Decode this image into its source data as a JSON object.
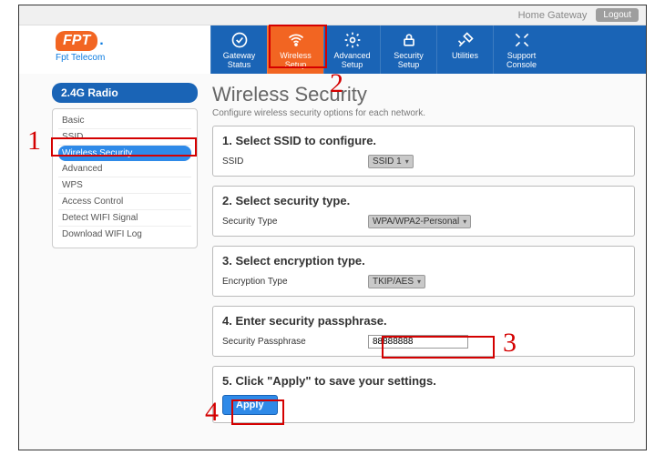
{
  "topbar": {
    "home": "Home Gateway",
    "logout": "Logout"
  },
  "brand": {
    "logo_main": "FPT",
    "logo_accent": ".",
    "sub": "Fpt Telecom"
  },
  "nav": [
    {
      "label": "Gateway\nStatus",
      "key": "gateway-status"
    },
    {
      "label": "Wireless\nSetup",
      "key": "wireless-setup"
    },
    {
      "label": "Advanced\nSetup",
      "key": "advanced-setup"
    },
    {
      "label": "Security\nSetup",
      "key": "security-setup"
    },
    {
      "label": "Utilities",
      "key": "utilities"
    },
    {
      "label": "Support\nConsole",
      "key": "support-console"
    }
  ],
  "sidebar": {
    "head": "2.4G Radio",
    "items": [
      "Basic",
      "SSID",
      "Wireless Security",
      "Advanced",
      "WPS",
      "Access Control",
      "Detect WIFI Signal",
      "Download WIFI Log"
    ],
    "active_index": 2
  },
  "page": {
    "title": "Wireless Security",
    "subtitle": "Configure wireless security options for each network."
  },
  "steps": {
    "s1": {
      "heading": "1. Select SSID to configure.",
      "label": "SSID",
      "value": "SSID 1"
    },
    "s2": {
      "heading": "2. Select security type.",
      "label": "Security Type",
      "value": "WPA/WPA2-Personal"
    },
    "s3": {
      "heading": "3. Select encryption type.",
      "label": "Encryption Type",
      "value": "TKIP/AES"
    },
    "s4": {
      "heading": "4. Enter security passphrase.",
      "label": "Security Passphrase",
      "value": "88888888"
    },
    "s5": {
      "heading": "5. Click \"Apply\" to save your settings.",
      "button": "Apply"
    }
  },
  "annotations": {
    "n1": "1",
    "n2": "2",
    "n3": "3",
    "n4": "4"
  }
}
